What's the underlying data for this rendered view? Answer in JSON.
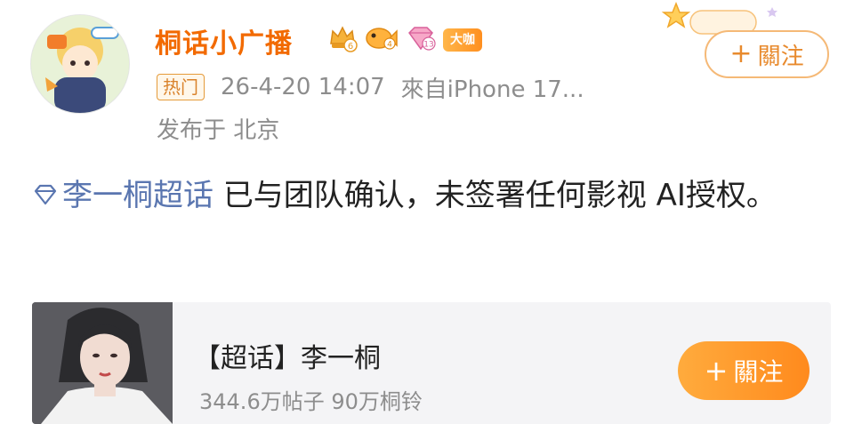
{
  "user": {
    "name": "桐话小广播",
    "avatar_icon": "avatar-image",
    "badges": [
      {
        "name": "crown-badge-icon",
        "level": "6"
      },
      {
        "name": "fish-badge-icon",
        "level": "4"
      },
      {
        "name": "diamond-badge-icon",
        "level": "13"
      },
      {
        "label": "大咖"
      }
    ]
  },
  "meta": {
    "hot_tag": "热门",
    "timestamp": "26-4-20 14:07",
    "source": "來自iPhone 17...",
    "location": "发布于 北京"
  },
  "follow_top": {
    "plus": "+",
    "label": "關注"
  },
  "post": {
    "topic_icon": "diamond-topic-icon",
    "topic": "李一桐超话",
    "body": " 已与团队确认，未签署任何影视 AI授权。"
  },
  "card": {
    "title": "【超话】李一桐",
    "stats": "344.6万帖子 90万桐铃",
    "image_icon": "portrait-image"
  },
  "follow_card": {
    "plus": "+",
    "label": "關注"
  },
  "colors": {
    "accent": "#f26a00",
    "link": "#5a76b0",
    "meta_gray": "#8d8d8d",
    "card_bg": "#f4f4f6",
    "follow_btn": "#ff8a1d"
  }
}
